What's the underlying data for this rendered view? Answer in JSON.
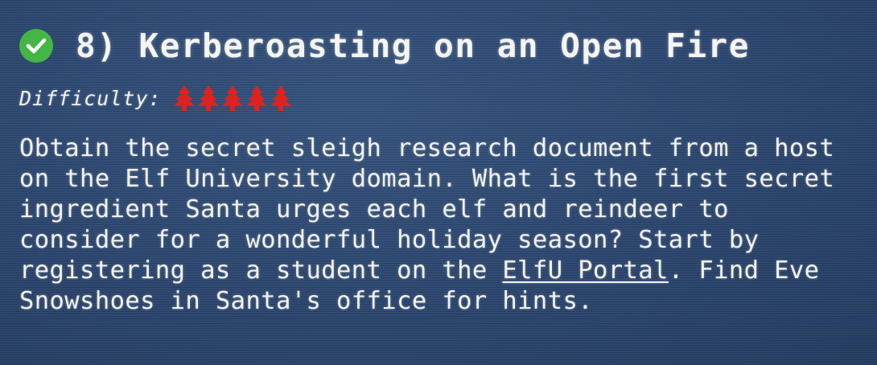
{
  "challenge": {
    "completed_icon": "check-circle-icon",
    "title": "8) Kerberoasting on an Open Fire",
    "difficulty_label": "Difficulty:",
    "difficulty_level": 5,
    "difficulty_max": 5,
    "difficulty_icon": "christmas-tree-icon",
    "difficulty_color": "#e0221e",
    "check_color": "#45b545",
    "description_before_link": "Obtain the secret sleigh research document from a host\non the Elf University domain. What is the first secret\ningredient Santa urges each elf and reindeer to\nconsider for a wonderful holiday season? Start by\nregistering as a student on the ",
    "link_text": "ElfU Portal",
    "description_after_link": ". Find Eve\nSnowshoes in Santa's office for hints."
  }
}
